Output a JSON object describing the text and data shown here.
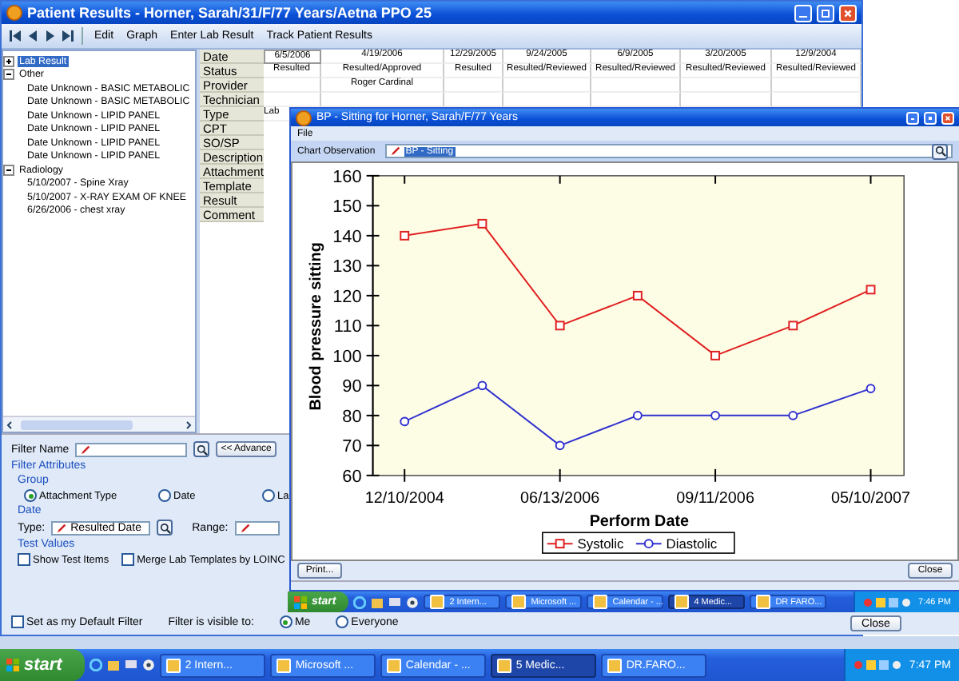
{
  "main_window": {
    "title": "Patient Results - Horner, Sarah/31/F/77 Years/Aetna PPO 25",
    "toolbar": [
      "Edit",
      "Graph",
      "Enter Lab Result",
      "Track Patient Results"
    ],
    "tree": [
      {
        "label": "Lab Result",
        "selected": true,
        "expanded": false
      },
      {
        "label": "Other",
        "selected": false,
        "expanded": true,
        "children": [
          {
            "label": "Date Unknown - BASIC METABOLIC"
          },
          {
            "label": "Date Unknown - BASIC METABOLIC"
          },
          {
            "label": "Date Unknown - LIPID PANEL"
          },
          {
            "label": "Date Unknown - LIPID PANEL"
          },
          {
            "label": "Date Unknown - LIPID PANEL"
          },
          {
            "label": "Date Unknown - LIPID PANEL"
          }
        ]
      },
      {
        "label": "Radiology",
        "selected": false,
        "expanded": true,
        "children": [
          {
            "label": "5/10/2007 - Spine Xray"
          },
          {
            "label": "5/10/2007 - X-RAY EXAM OF KNEE"
          },
          {
            "label": "6/26/2006 - chest xray"
          }
        ]
      }
    ],
    "row_labels": [
      "Date",
      "Status",
      "Provider",
      "Technician",
      "Type",
      "CPT",
      "SO/SP",
      "Description",
      "Attachment",
      "Template",
      "Result",
      "Comment"
    ],
    "results": [
      {
        "date": "6/5/2006",
        "status": "Resulted",
        "type": "Lab"
      },
      {
        "date": "4/19/2006",
        "status": "Resulted/Approved",
        "provider": "Roger Cardinal"
      },
      {
        "date": "12/29/2005",
        "status": "Resulted"
      },
      {
        "date": "9/24/2005",
        "status": "Resulted/Reviewed"
      },
      {
        "date": "6/9/2005",
        "status": "Resulted/Reviewed"
      },
      {
        "date": "3/20/2005",
        "status": "Resulted/Reviewed"
      },
      {
        "date": "12/9/2004",
        "status": "Resulted/Reviewed"
      }
    ],
    "filter": {
      "name_label": "Filter Name",
      "advanced_button": "<< Advance",
      "attributes_title": "Filter Attributes",
      "group_title": "Group",
      "group_options": [
        {
          "label": "Attachment Type",
          "selected": true
        },
        {
          "label": "Date",
          "selected": false
        },
        {
          "label": "La",
          "selected": false
        }
      ],
      "date_title": "Date",
      "type_label": "Type:",
      "type_value": "Resulted Date",
      "range_label": "Range:",
      "test_values_title": "Test Values",
      "test_options": [
        {
          "label": "Show Test Items",
          "checked": false
        },
        {
          "label": "Merge Lab Templates by LOINC",
          "checked": false
        }
      ],
      "default_filter": {
        "label": "Set as my Default Filter",
        "checked": false
      },
      "visible_label": "Filter is visible to:",
      "visible_options": [
        {
          "label": "Me",
          "selected": true
        },
        {
          "label": "Everyone",
          "selected": false
        }
      ]
    },
    "close_button": "Close"
  },
  "chart_window": {
    "title": "BP - Sitting for Horner, Sarah/F/77 Years",
    "menu": [
      "File"
    ],
    "observation_label": "Chart Observation",
    "observation_value": "BP - Sitting",
    "chart_data": {
      "type": "line",
      "xlabel": "Perform Date",
      "ylabel": "Blood pressure sitting",
      "categories": [
        "12/10/2004",
        null,
        "06/13/2006",
        null,
        "09/11/2006",
        null,
        "05/10/2007"
      ],
      "legend": true,
      "series": [
        {
          "name": "Systolic",
          "color": "#e02020",
          "marker": "square",
          "values": [
            140,
            144,
            110,
            120,
            100,
            110,
            122
          ]
        },
        {
          "name": "Diastolic",
          "color": "#3030d0",
          "marker": "circle",
          "values": [
            78,
            90,
            70,
            80,
            80,
            80,
            89
          ]
        }
      ],
      "ylim": [
        60,
        160
      ],
      "yticks": [
        60,
        70,
        80,
        90,
        100,
        110,
        120,
        130,
        140,
        150,
        160
      ]
    },
    "buttons": [
      "Print...",
      "Close"
    ]
  },
  "inner_taskbar": {
    "start": "start",
    "tasks": [
      {
        "label": "2 Intern...",
        "selected": false
      },
      {
        "label": "Microsoft ...",
        "selected": false
      },
      {
        "label": "Calendar - ...",
        "selected": false
      },
      {
        "label": "4 Medic...",
        "selected": true
      },
      {
        "label": "DR FARO...",
        "selected": false
      }
    ],
    "clock": "7:46 PM"
  },
  "taskbar": {
    "start": "start",
    "tasks": [
      {
        "label": "2 Intern...",
        "selected": false
      },
      {
        "label": "Microsoft ...",
        "selected": false
      },
      {
        "label": "Calendar - ...",
        "selected": false
      },
      {
        "label": "5 Medic...",
        "selected": true
      },
      {
        "label": "DR.FARO...",
        "selected": false
      }
    ],
    "clock": "7:47 PM"
  }
}
